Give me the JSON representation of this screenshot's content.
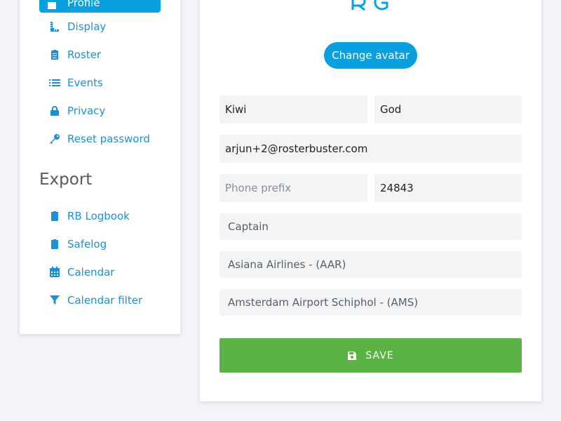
{
  "sidebar": {
    "active_item": "Profile",
    "items": [
      {
        "label": "Display",
        "icon": "ruler-icon"
      },
      {
        "label": "Roster",
        "icon": "clipboard-list-icon"
      },
      {
        "label": "Events",
        "icon": "list-icon"
      },
      {
        "label": "Privacy",
        "icon": "lock-icon"
      },
      {
        "label": "Reset password",
        "icon": "key-icon"
      }
    ],
    "export_title": "Export",
    "export_items": [
      {
        "label": "RB Logbook",
        "icon": "clipboard-icon"
      },
      {
        "label": "Safelog",
        "icon": "clipboard-icon"
      },
      {
        "label": "Calendar",
        "icon": "calendar-icon"
      },
      {
        "label": "Calendar filter",
        "icon": "filter-icon"
      }
    ]
  },
  "profile": {
    "change_avatar_label": "Change avatar",
    "first_name": "Kiwi",
    "last_name": "God",
    "email": "arjun+2@rosterbuster.com",
    "phone_prefix_placeholder": "Phone prefix",
    "phone_number": "24843",
    "rank": "Captain",
    "airline": "Asiana Airlines - (AAR)",
    "base": "Amsterdam Airport Schiphol - (AMS)",
    "save_label": "SAVE"
  },
  "colors": {
    "accent": "#0aa0e0",
    "link": "#1c8fd6",
    "save": "#5cb345",
    "background": "#f3f4f8"
  }
}
